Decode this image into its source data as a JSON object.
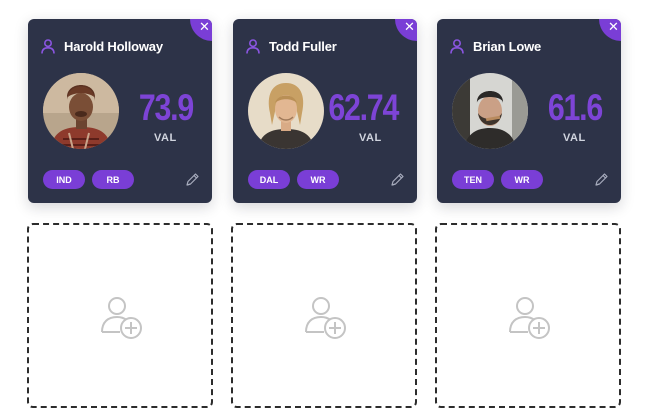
{
  "players": [
    {
      "name": "Harold Holloway",
      "value": "73.9",
      "value_label": "VAL",
      "team": "IND",
      "position": "RB",
      "close_icon": "✕",
      "photo_icon": "player-photo",
      "user_icon": "user-icon",
      "edit_icon": "pencil-icon"
    },
    {
      "name": "Todd Fuller",
      "value": "62.74",
      "value_label": "VAL",
      "team": "DAL",
      "position": "WR",
      "close_icon": "✕",
      "photo_icon": "player-photo",
      "user_icon": "user-icon",
      "edit_icon": "pencil-icon"
    },
    {
      "name": "Brian Lowe",
      "value": "61.6",
      "value_label": "VAL",
      "team": "TEN",
      "position": "WR",
      "close_icon": "✕",
      "photo_icon": "player-photo",
      "user_icon": "user-icon",
      "edit_icon": "pencil-icon"
    }
  ],
  "empty_slots": [
    {
      "icon": "add-user-icon"
    },
    {
      "icon": "add-user-icon"
    },
    {
      "icon": "add-user-icon"
    }
  ],
  "colors": {
    "card_background": "#2d3348",
    "accent_purple": "#7a3ed6",
    "value_purple": "#7d44d6",
    "dashed_border": "#2c2c2c",
    "slot_icon_gray": "#c4c4c4"
  }
}
